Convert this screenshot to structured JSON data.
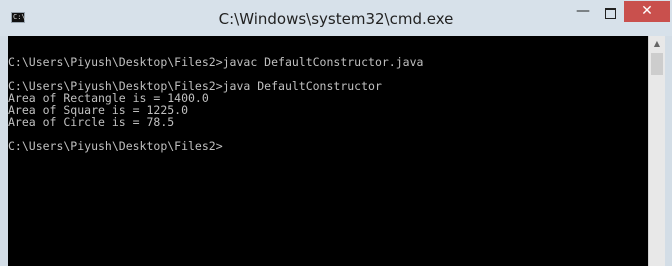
{
  "window": {
    "title": "C:\\Windows\\system32\\cmd.exe",
    "app_icon_text": "C:\\.",
    "buttons": {
      "minimize": "—",
      "close": "✕"
    }
  },
  "console": {
    "lines": [
      "",
      "C:\\Users\\Piyush\\Desktop\\Files2>javac DefaultConstructor.java",
      "",
      "C:\\Users\\Piyush\\Desktop\\Files2>java DefaultConstructor",
      "Area of Rectangle is = 1400.0",
      "Area of Square is = 1225.0",
      "Area of Circle is = 78.5",
      "",
      "C:\\Users\\Piyush\\Desktop\\Files2>"
    ]
  },
  "scrollbar": {
    "up_arrow": "▲"
  }
}
